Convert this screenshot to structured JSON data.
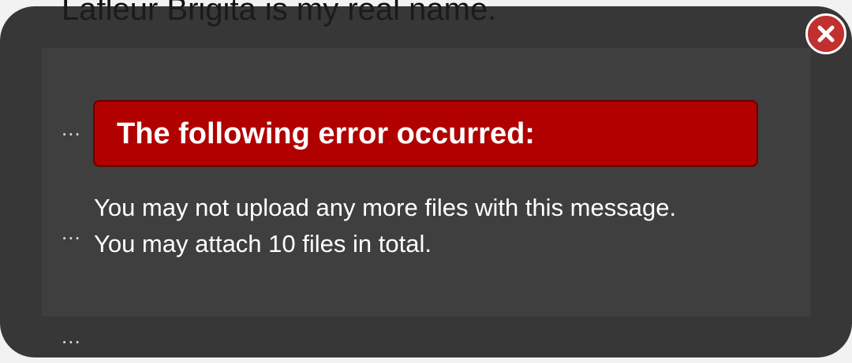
{
  "background": {
    "heading": "Lafleur Brigita is my real name.",
    "ellipsis": "..."
  },
  "dialog": {
    "error_title": "The following error occurred:",
    "message_lines": [
      "You may not upload any more files with this message.",
      "You may attach 10 files in total."
    ]
  },
  "colors": {
    "error_banner": "#b00000",
    "close_button": "#c0302f",
    "overlay": "#2a2a2a",
    "dialog_body": "#3f3f3f"
  },
  "icons": {
    "close": "close-icon"
  }
}
